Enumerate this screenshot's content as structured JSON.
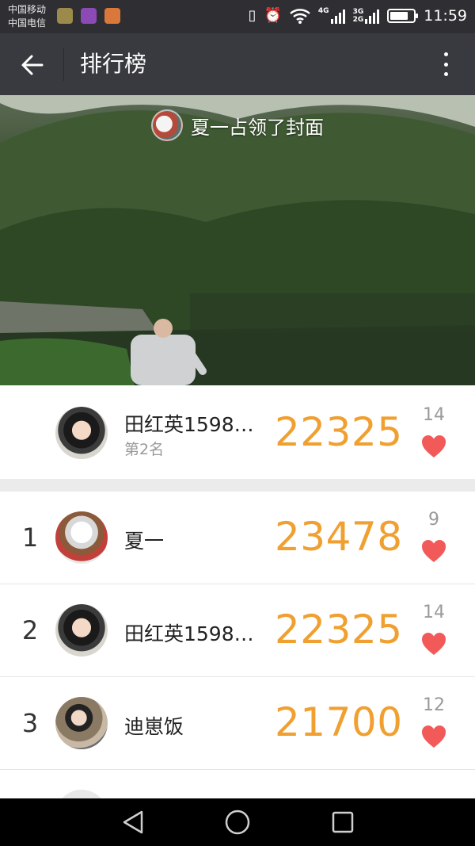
{
  "status_bar": {
    "carrier_1": "中国移动",
    "carrier_2": "中国电信",
    "network_4g": "4G",
    "network_3g": "3G",
    "network_2g": "2G",
    "time": "11:59",
    "icons": [
      "notification-app-icon",
      "gallery-notification-icon",
      "sync-notification-icon",
      "vibrate-icon",
      "alarm-icon",
      "wifi-icon",
      "signal-icon",
      "battery-icon"
    ]
  },
  "app_bar": {
    "title": "排行榜",
    "back_icon": "back-arrow-icon",
    "more_icon": "more-vertical-icon"
  },
  "cover": {
    "banner_text": "夏一占领了封面"
  },
  "my_rank": {
    "name": "田红英1598…",
    "rank_label": "第2名",
    "steps": "22325",
    "likes": "14"
  },
  "leaderboard": [
    {
      "rank": "1",
      "name": "夏一",
      "steps": "23478",
      "likes": "9"
    },
    {
      "rank": "2",
      "name": "田红英1598…",
      "steps": "22325",
      "likes": "14"
    },
    {
      "rank": "3",
      "name": "迪崽饭",
      "steps": "21700",
      "likes": "12"
    }
  ],
  "colors": {
    "accent_steps": "#f0a030",
    "heart": "#f25a5a",
    "app_bar": "#393a3f",
    "status_bar": "#2f2f33"
  }
}
